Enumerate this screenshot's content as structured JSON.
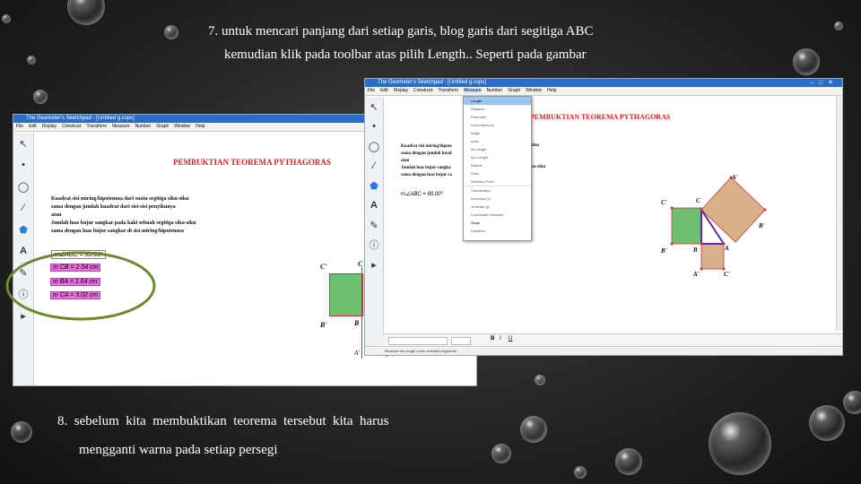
{
  "slide": {
    "caption_top_line1": "7. untuk mencari panjang dari setiap garis, blog garis dari segitiga ABC",
    "caption_top_line2": "kemudian klik pada toolbar atas pilih Length.. Seperti pada gambar",
    "caption_bottom_line1": "8.  sebelum  kita  membuktikan  teorema  tersebut  kita  harus",
    "caption_bottom_line2": "mengganti warna pada setiap persegi"
  },
  "colors": {
    "title_red": "#e02020",
    "square_green": "#6fbf73",
    "square_tan": "#d9b08c",
    "measure_pink": "#ee6be0",
    "circle_olive": "#6e8a2e",
    "triangle_purple": "#5b2fa0"
  },
  "left_window": {
    "title": "The Geometer's Sketchpad - [Untitled g.csps]",
    "menu": [
      "File",
      "Edit",
      "Display",
      "Construct",
      "Transform",
      "Measure",
      "Number",
      "Graph",
      "Window",
      "Help"
    ],
    "heading": "PEMBUKTIAN TEOREMA PYTHAGORAS",
    "text_lines": [
      "Kuadrat sisi miring/hipotenusa dari suatu segitiga siku-siku",
      "sama dengan jumlah kuadrat dari sisi-sisi penyikunya",
      "atau",
      "Jumlah luas bujur sangkar pada kaki sebuah segitiga siku-siku",
      "sama dengan luas bujur sangkar di sisi miring/hipotenusa"
    ],
    "angle_measure": "m∠ABC = 90.00°",
    "lengths": [
      "m CB = 2.54 cm",
      "m BA = 1.64 cm",
      "m CA = 3.02 cm"
    ],
    "points": {
      "c_prime": "C'",
      "c": "C",
      "b_prime": "B'",
      "b": "B",
      "a_prime": "A'",
      "c2": "C"
    }
  },
  "right_window": {
    "title": "The Geometer's Sketchpad - [Untitled g.csps]",
    "menu": [
      "File",
      "Edit",
      "Display",
      "Construct",
      "Transform",
      "Measure",
      "Number",
      "Graph",
      "Window",
      "Help"
    ],
    "heading": "PEMBUKTIAN TEOREMA PYTHAGORAS",
    "text_lines": [
      "Kuadrat sisi miring/hipote",
      "sama dengan jumlah kuad",
      "atau",
      "Jumlah luas bujur sangka",
      "sama dengan luas bujur sa"
    ],
    "text_tail": [
      "siku",
      "ku-siku"
    ],
    "angle_measure": "m∠ABC = 90.00°",
    "measure_menu": [
      "Length",
      "Distance",
      "Perimeter",
      "Circumference",
      "Angle",
      "Area",
      "Arc Angle",
      "Arc Length",
      "Radius",
      "Ratio",
      "Selected Point",
      "Coordinates",
      "Abscissa (x)",
      "Ordinate (y)",
      "Coordinate Distance",
      "Slope",
      "Equation"
    ],
    "measure_menu_active": "Length",
    "points": {
      "a_prime_top": "A'",
      "c_prime": "C'",
      "c": "C",
      "b_prime_right": "B'",
      "b_prime": "B'",
      "b": "B",
      "a": "A",
      "a_prime": "A'",
      "c_prime_bottom": "C'"
    },
    "status_text": "Measure the length of the selected segments",
    "format": [
      "B",
      "I",
      "U"
    ]
  }
}
